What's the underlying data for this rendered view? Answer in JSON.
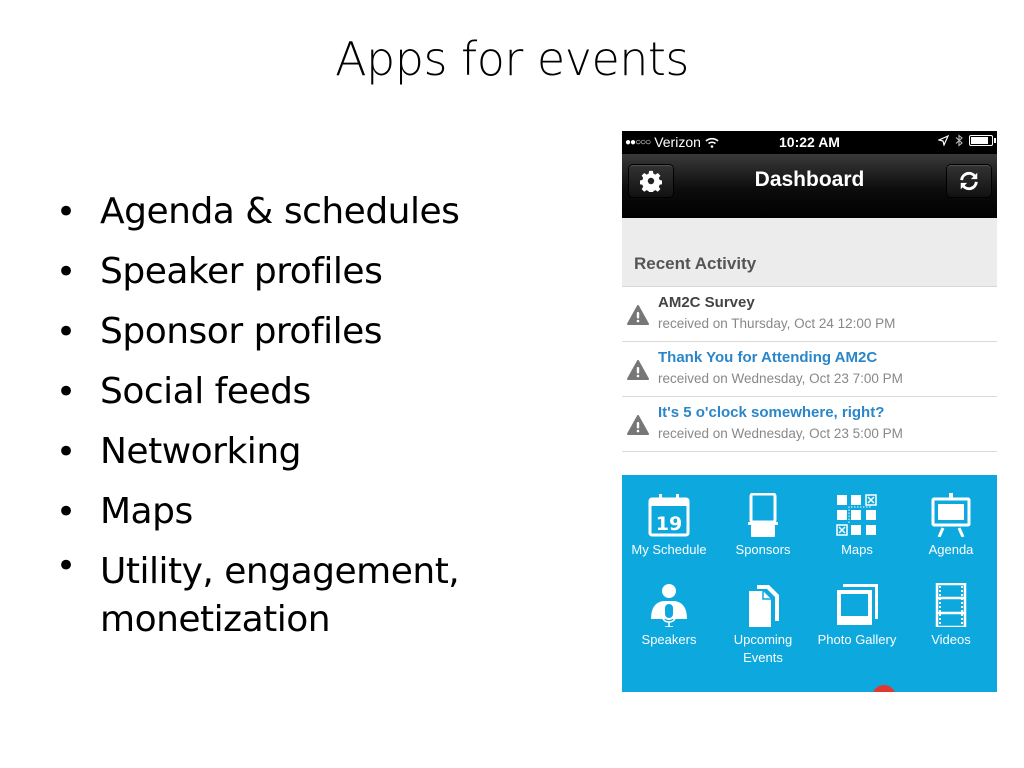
{
  "slide": {
    "title": "Apps for events",
    "bullets": [
      "Agenda & schedules",
      "Speaker profiles",
      "Sponsor profiles",
      "Social feeds",
      "Networking",
      "Maps",
      "Utility, engagement, monetization"
    ]
  },
  "phone": {
    "status": {
      "carrier": "Verizon",
      "signal": "●●○○○",
      "time": "10:22 AM",
      "icons": [
        "location-icon",
        "bluetooth-icon",
        "battery-icon"
      ]
    },
    "navbar": {
      "title": "Dashboard",
      "left_icon": "gear-icon",
      "right_icon": "refresh-icon"
    },
    "section_header": "Recent Activity",
    "activity": [
      {
        "title": "AM2C Survey",
        "subtitle": "received on Thursday, Oct 24 12:00 PM",
        "color": "#444444"
      },
      {
        "title": "Thank You for Attending AM2C",
        "subtitle": "received on Wednesday, Oct 23 7:00 PM",
        "color": "#2a86c8"
      },
      {
        "title": "It's 5 o'clock somewhere, right?",
        "subtitle": "received on Wednesday, Oct 23 5:00 PM",
        "color": "#2a86c8"
      }
    ],
    "tiles": [
      {
        "label": "My Schedule",
        "icon": "calendar-icon",
        "calendar_day": "19"
      },
      {
        "label": "Sponsors",
        "icon": "booth-icon"
      },
      {
        "label": "Maps",
        "icon": "map-grid-icon"
      },
      {
        "label": "Agenda",
        "icon": "easel-icon"
      },
      {
        "label": "Speakers",
        "icon": "speaker-mic-icon"
      },
      {
        "label": "Upcoming Events",
        "icon": "documents-icon"
      },
      {
        "label": "Photo Gallery",
        "icon": "photos-icon"
      },
      {
        "label": "Videos",
        "icon": "film-icon"
      }
    ],
    "accent_color": "#0ca8de"
  }
}
